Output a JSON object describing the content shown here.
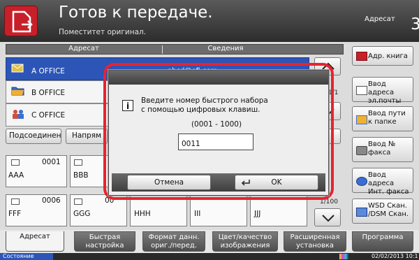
{
  "header": {
    "title": "Готов к передаче.",
    "subtitle": "Поместитет оригинал.",
    "destination_label": "Адресат",
    "destination_count": "3"
  },
  "list": {
    "col_destination": "Адресат",
    "col_details": "Сведения",
    "rows": [
      {
        "name": "A OFFICE",
        "detail": "abcd@efi.com",
        "icon": "envelope-icon",
        "color": "#e0c040"
      },
      {
        "name": "B OFFICE",
        "detail": "",
        "icon": "folder-icon",
        "color": "#3a6fd0"
      },
      {
        "name": "C OFFICE",
        "detail": "",
        "icon": "group-icon",
        "color": "#d05040"
      }
    ],
    "page_indicator": "1/1"
  },
  "addressbook": {
    "btn_connected": "Подсоединен о",
    "btn_direct": "Напрям",
    "cells": [
      {
        "num": "0001",
        "name": "AAA"
      },
      {
        "num": "",
        "name": "BBB"
      },
      {
        "num": "0006",
        "name": "FFF"
      },
      {
        "num": "00",
        "name": "GGG"
      },
      {
        "num": "",
        "name": "HHH"
      },
      {
        "num": "",
        "name": "III"
      },
      {
        "num": "",
        "name": "JJJ"
      }
    ],
    "page_indicator": "1/100"
  },
  "right": {
    "address_book": "Адр. книга",
    "email": "Ввод адреса эл.почты",
    "folder": "Ввод пути к папке",
    "fax": "Ввод № факса",
    "ifax": "Ввод адреса Инт. факса",
    "wsd": "WSD Скан. /DSM Скан."
  },
  "tabs": [
    {
      "label": "Адресат"
    },
    {
      "label": "Быстрая настройка"
    },
    {
      "label": "Формат данн. ориг./перед."
    },
    {
      "label": "Цвет/качество изображения"
    },
    {
      "label": "Расширенная установка"
    },
    {
      "label": "Программа"
    }
  ],
  "status": {
    "left": "Состояние",
    "datetime": "02/02/2013 10:1"
  },
  "dialog": {
    "message_line1": "Введите номер быстрого набора",
    "message_line2": "с помощью цифровых клавиш.",
    "range": "(0001 - 1000)",
    "input_value": "0011",
    "cancel": "Отмена",
    "ok": "OK"
  },
  "colors": {
    "accent": "#e8232f",
    "selection": "#2c55b7"
  }
}
